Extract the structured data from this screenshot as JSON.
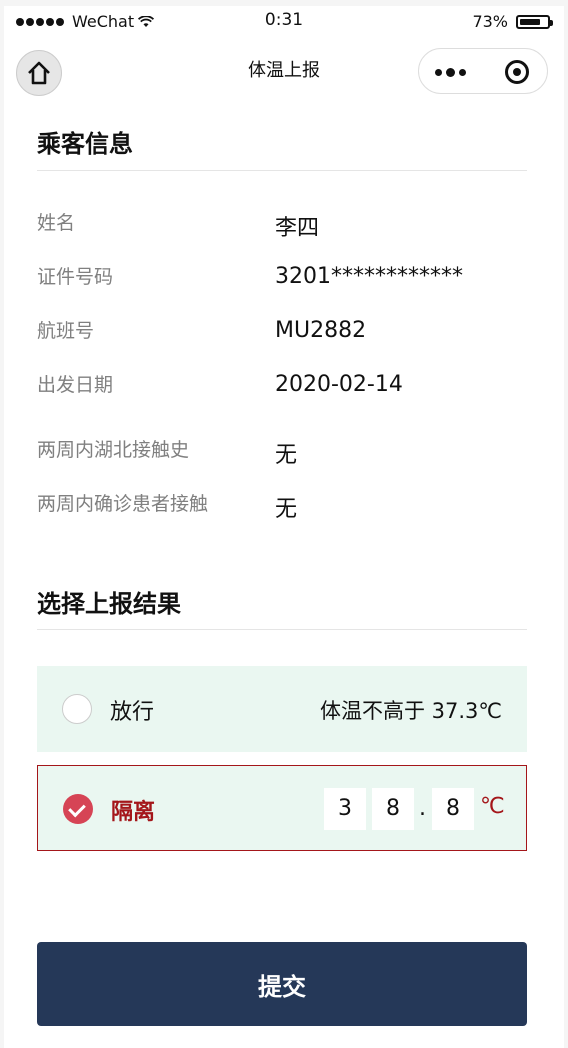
{
  "status_bar": {
    "carrier": "WeChat",
    "time": "0:31",
    "battery": "73%"
  },
  "nav": {
    "title": "体温上报"
  },
  "passenger": {
    "title": "乘客信息",
    "rows": [
      {
        "label": "姓名",
        "value": "李四"
      },
      {
        "label": "证件号码",
        "value": "3201************"
      },
      {
        "label": "航班号",
        "value": "MU2882"
      },
      {
        "label": "出发日期",
        "value": "2020-02-14"
      },
      {
        "label": "两周内湖北接触史",
        "value": "无"
      },
      {
        "label": "两周内确诊患者接触",
        "value": "无"
      }
    ]
  },
  "result": {
    "title": "选择上报结果",
    "release": {
      "label": "放行",
      "desc": "体温不高于 37.3℃",
      "selected": false
    },
    "quarantine": {
      "label": "隔离",
      "selected": true,
      "digit1": "3",
      "digit2": "8",
      "dot": ".",
      "digit3": "8",
      "unit": "℃"
    }
  },
  "submit_label": "提交",
  "colors": {
    "accent_red": "#a4161a",
    "check_red": "#d64455",
    "option_bg": "#eaf7f1",
    "button_navy": "#253858"
  }
}
